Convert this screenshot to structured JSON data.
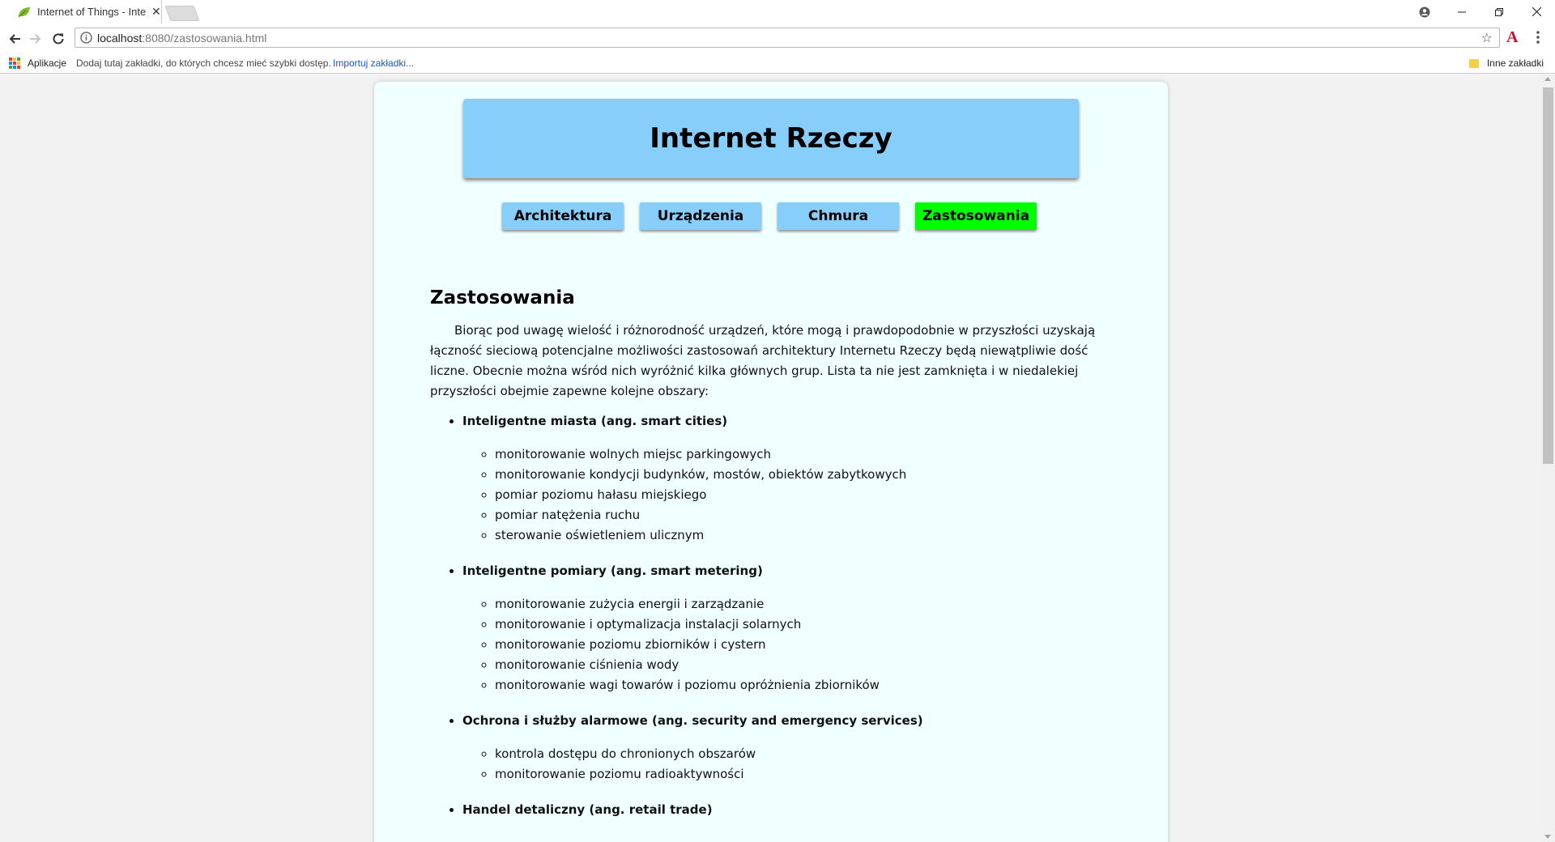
{
  "browser": {
    "tab_title": "Internet of Things - Inter",
    "tab_close": "✕",
    "url_host": "localhost",
    "url_path": ":8080/zastosowania.html",
    "bookmarks_bar": {
      "apps_label": "Aplikacje",
      "hint": "Dodaj tutaj zakładki, do których chcesz mieć szybki dostęp.",
      "import_link": "Importuj zakładki...",
      "other_bookmarks": "Inne zakładki"
    },
    "extension_letter": "A"
  },
  "site": {
    "title": "Internet Rzeczy",
    "nav": [
      {
        "label": "Architektura",
        "active": false
      },
      {
        "label": "Urządzenia",
        "active": false
      },
      {
        "label": "Chmura",
        "active": false
      },
      {
        "label": "Zastosowania",
        "active": true
      }
    ],
    "colors": {
      "page_bg": "#f0ffff",
      "header_bg": "#87cefa",
      "nav_bg": "#87cefa",
      "nav_active_bg": "#00ff00"
    }
  },
  "content": {
    "heading": "Zastosowania",
    "intro": "Biorąc pod uwagę wielość i różnorodność urządzeń, które mogą i prawdopodobnie w przyszłości uzyskają łączność sieciową potencjalne możliwości zastosowań architektury Internetu Rzeczy będą niewątpliwie dość liczne. Obecnie można wśród nich wyróżnić kilka głównych grup. Lista ta nie jest zamknięta i w niedalekiej przyszłości obejmie zapewne kolejne obszary:",
    "groups": [
      {
        "title": "Inteligentne miasta (ang. smart cities)",
        "items": [
          "monitorowanie wolnych miejsc parkingowych",
          "monitorowanie kondycji budynków, mostów, obiektów zabytkowych",
          "pomiar poziomu hałasu miejskiego",
          "pomiar natężenia ruchu",
          "sterowanie oświetleniem ulicznym"
        ]
      },
      {
        "title": "Inteligentne pomiary (ang. smart metering)",
        "items": [
          "monitorowanie zużycia energii i zarządzanie",
          "monitorowanie i optymalizacja instalacji solarnych",
          "monitorowanie poziomu zbiorników i cystern",
          "monitorowanie ciśnienia wody",
          "monitorowanie wagi towarów i poziomu opróżnienia zbiorników"
        ]
      },
      {
        "title": "Ochrona i służby alarmowe (ang. security and emergency services)",
        "items": [
          "kontrola dostępu do chronionych obszarów",
          "monitorowanie poziomu radioaktywności"
        ]
      },
      {
        "title": "Handel detaliczny (ang. retail trade)",
        "items": []
      }
    ]
  }
}
